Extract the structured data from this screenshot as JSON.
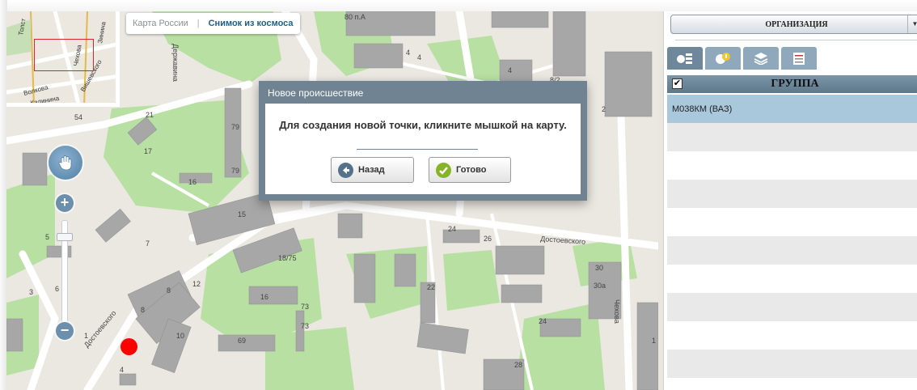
{
  "map": {
    "switch": {
      "option1": "Карта России",
      "separator": "|",
      "option2": "Снимок из космоса"
    },
    "labels": [
      {
        "id": "lbl-80a",
        "text": "80 п.А"
      },
      {
        "id": "lbl-54",
        "text": "54"
      },
      {
        "id": "lbl-21",
        "text": "21"
      },
      {
        "id": "lbl-17",
        "text": "17"
      },
      {
        "id": "lbl-79a",
        "text": "79"
      },
      {
        "id": "lbl-79b",
        "text": "79"
      },
      {
        "id": "lbl-16",
        "text": "16"
      },
      {
        "id": "lbl-15",
        "text": "15"
      },
      {
        "id": "lbl-4",
        "text": "4"
      },
      {
        "id": "lbl-4b",
        "text": "4"
      },
      {
        "id": "lbl-8-2",
        "text": "8/2"
      },
      {
        "id": "lbl-2",
        "text": "2"
      },
      {
        "id": "lbl-4c",
        "text": "4"
      },
      {
        "id": "lbl-24",
        "text": "24"
      },
      {
        "id": "lbl-26",
        "text": "26"
      },
      {
        "id": "lbl-18-75",
        "text": "18/75"
      },
      {
        "id": "lbl-12",
        "text": "12"
      },
      {
        "id": "lbl-8",
        "text": "8"
      },
      {
        "id": "lbl-8b",
        "text": "8"
      },
      {
        "id": "lbl-7",
        "text": "7"
      },
      {
        "id": "lbl-5",
        "text": "5"
      },
      {
        "id": "lbl-6",
        "text": "6"
      },
      {
        "id": "lbl-3",
        "text": "3"
      },
      {
        "id": "lbl-16b",
        "text": "16"
      },
      {
        "id": "lbl-73",
        "text": "73"
      },
      {
        "id": "lbl-73b",
        "text": "73"
      },
      {
        "id": "lbl-69",
        "text": "69"
      },
      {
        "id": "lbl-10",
        "text": "10"
      },
      {
        "id": "lbl-1",
        "text": "1"
      },
      {
        "id": "lbl-4d",
        "text": "4"
      },
      {
        "id": "lbl-22",
        "text": "22"
      },
      {
        "id": "lbl-24b",
        "text": "24"
      },
      {
        "id": "lbl-30",
        "text": "30"
      },
      {
        "id": "lbl-30a",
        "text": "30а"
      },
      {
        "id": "lbl-28",
        "text": "28"
      },
      {
        "id": "lbl-1b",
        "text": "1"
      },
      {
        "id": "street-dostoevskogo-1",
        "text": "Достоевского"
      },
      {
        "id": "street-dostoevskogo-2",
        "text": "Достоевского"
      },
      {
        "id": "street-chekhova",
        "text": "Чехова"
      },
      {
        "id": "street-derzhavina",
        "text": "Державина"
      }
    ],
    "overview_labels": [
      "Толст",
      "Зинина",
      "Чехова",
      "Вишевского",
      "Волкова",
      "Калинина"
    ]
  },
  "dialog": {
    "title": "Новое происшествие",
    "message": "Для создания новой точки, кликните мышкой на карту.",
    "back_label": "Назад",
    "done_label": "Готово"
  },
  "panel": {
    "organization_label": "ОРГАНИЗАЦИЯ",
    "group_label": "ГРУППА",
    "group_checked": "✔",
    "vehicles": [
      "М038КМ (ВАЗ)"
    ]
  },
  "colors": {
    "accent": "#6f8392",
    "marker": "#ff0000",
    "selected_row": "#a9c8dc",
    "done_icon": "#86b426"
  },
  "icons": [
    "pan-icon",
    "zoom-in-icon",
    "zoom-out-icon",
    "back-icon",
    "check-icon",
    "list-tab-icon",
    "vehicle-tab-icon",
    "layers-tab-icon",
    "report-tab-icon"
  ]
}
